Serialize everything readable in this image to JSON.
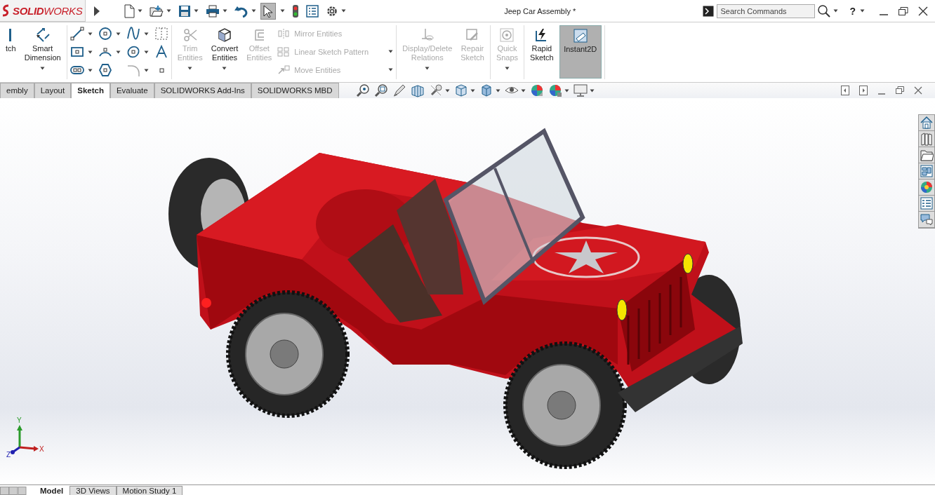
{
  "logo": {
    "text": "**SOLID**WORKS"
  },
  "title": "Jeep Car Assembly *",
  "search": {
    "placeholder": "Search Commands"
  },
  "help": {
    "label": "?"
  },
  "ribbon_groups": [
    [
      {
        "kind": "large",
        "label": "tch",
        "disabled": false,
        "selected": false,
        "caret": false
      },
      {
        "kind": "large",
        "label": "Smart Dimension",
        "disabled": false,
        "selected": false,
        "caret": true
      }
    ],
    [
      {
        "kind": "tools"
      }
    ],
    [
      {
        "kind": "large",
        "label": "Trim Entities",
        "disabled": true,
        "selected": false,
        "caret": true
      },
      {
        "kind": "large",
        "label": "Convert Entities",
        "disabled": false,
        "selected": false,
        "caret": true
      },
      {
        "kind": "large",
        "label": "Offset Entities",
        "disabled": true,
        "selected": false,
        "caret": false
      },
      {
        "kind": "stack",
        "items": [
          {
            "label": "Mirror Entities",
            "disabled": true,
            "caret": false
          },
          {
            "label": "Linear Sketch Pattern",
            "disabled": true,
            "caret": true
          },
          {
            "label": "Move Entities",
            "disabled": true,
            "caret": true
          }
        ]
      }
    ],
    [
      {
        "kind": "large",
        "label": "Display/Delete Relations",
        "disabled": true,
        "selected": false,
        "caret": true
      },
      {
        "kind": "large",
        "label": "Repair Sketch",
        "disabled": true,
        "selected": false,
        "caret": false
      }
    ],
    [
      {
        "kind": "large",
        "label": "Quick Snaps",
        "disabled": true,
        "selected": false,
        "caret": true
      }
    ],
    [
      {
        "kind": "large",
        "label": "Rapid Sketch",
        "disabled": false,
        "selected": false,
        "caret": false
      },
      {
        "kind": "large",
        "label": "Instant2D",
        "disabled": false,
        "selected": true,
        "caret": false
      }
    ]
  ],
  "tabs": [
    {
      "label": "embly",
      "selected": false
    },
    {
      "label": "Layout",
      "selected": false
    },
    {
      "label": "Sketch",
      "selected": true
    },
    {
      "label": "Evaluate",
      "selected": false
    },
    {
      "label": "SOLIDWORKS Add-Ins",
      "selected": false
    },
    {
      "label": "SOLIDWORKS MBD",
      "selected": false
    }
  ],
  "triad": {
    "x": "X",
    "y": "Y",
    "z": "Z"
  },
  "model_tabs": [
    {
      "label": "Model",
      "selected": true
    },
    {
      "label": "3D Views",
      "selected": false
    },
    {
      "label": "Motion Study 1",
      "selected": false
    }
  ]
}
